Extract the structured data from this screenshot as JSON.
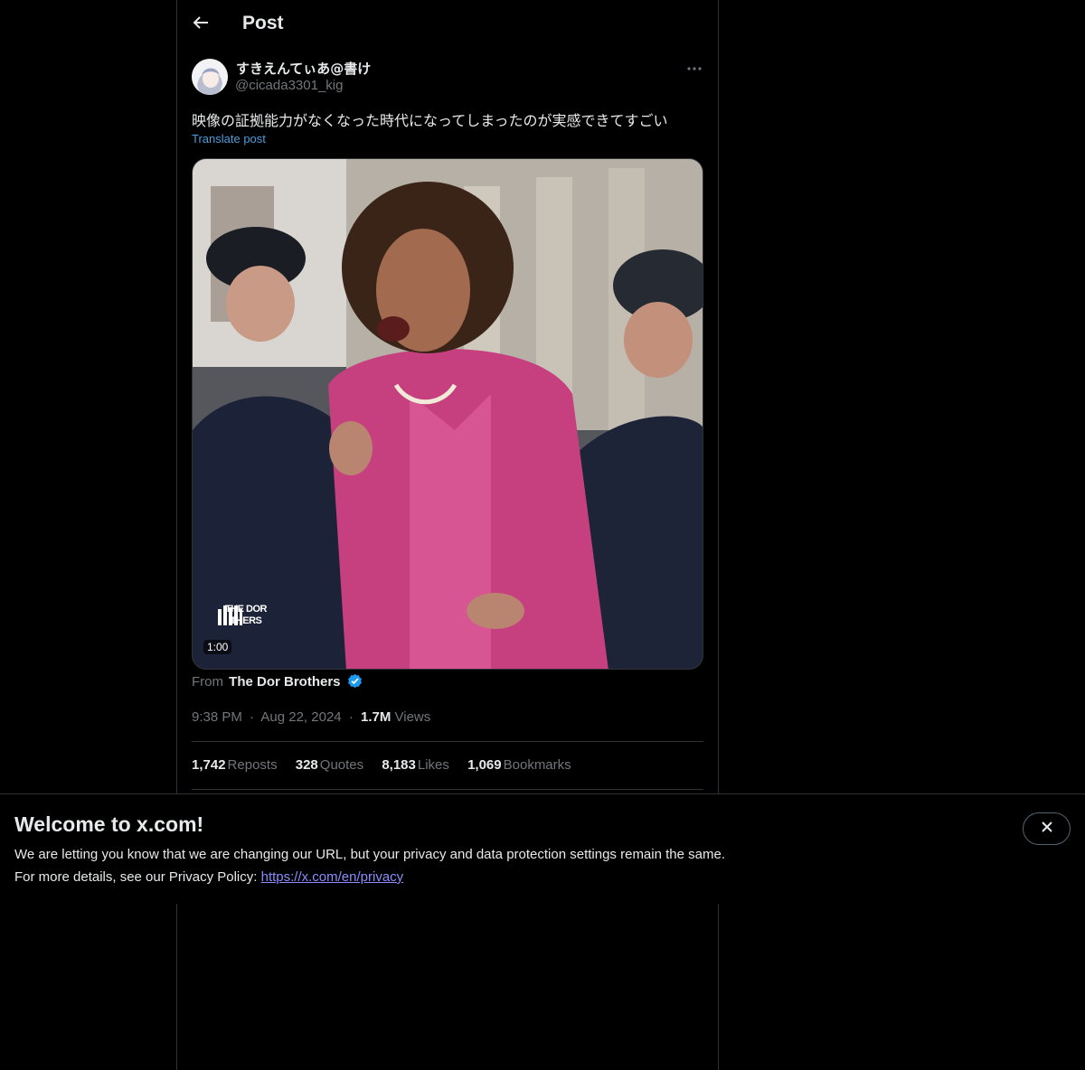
{
  "header": {
    "title": "Post"
  },
  "author": {
    "display_name": "すきえんてぃあ@書け",
    "handle": "@cicada3301_kig"
  },
  "post": {
    "text": "映像の証拠能力がなくなった時代になってしまったのが実感できてすごい",
    "translate_label": "Translate post",
    "media": {
      "duration": "1:00",
      "watermark_line1": "THE DOR",
      "watermark_line2": "THERS"
    },
    "source": {
      "prefix": "From",
      "name": "The Dor Brothers"
    },
    "time": "9:38 PM",
    "date": "Aug 22, 2024",
    "views_count": "1.7M",
    "views_label": "Views",
    "separator": "·"
  },
  "stats": {
    "reposts": {
      "count": "1,742",
      "label": "Reposts"
    },
    "quotes": {
      "count": "328",
      "label": "Quotes"
    },
    "likes": {
      "count": "8,183",
      "label": "Likes"
    },
    "bookmarks": {
      "count": "1,069",
      "label": "Bookmarks"
    }
  },
  "banner": {
    "title": "Welcome to x.com!",
    "line1": "We are letting you know that we are changing our URL, but your privacy and data protection settings remain the same.",
    "line2_prefix": "For more details, see our Privacy Policy:",
    "link": "https://x.com/en/privacy"
  },
  "icons": {
    "back": "arrow-left-icon",
    "more": "more-horizontal-icon",
    "verified": "verified-badge-icon",
    "close": "close-icon"
  },
  "colors": {
    "background": "#000000",
    "text_primary": "#e7e9ea",
    "text_secondary": "#71767b",
    "link": "#4d9ddb",
    "verified": "#1d9bf0",
    "border": "#2f3336"
  }
}
